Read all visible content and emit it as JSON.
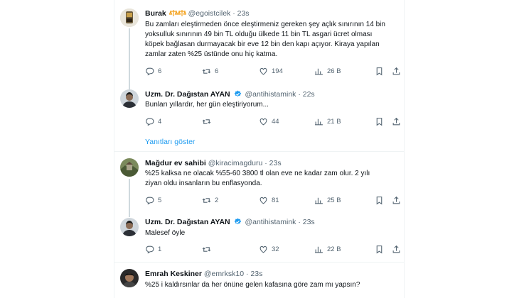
{
  "tweets": [
    {
      "name": "Burak",
      "handle": "@egoistcilek",
      "time": "· 23s",
      "lines": [
        "Bu zamları eleştirmeden önce eleştirmeniz gereken şey açlık sınırının 14 bin",
        "yoksulluk sınırının 49 bin TL olduğu ülkede 11 bin TL asgari ücret olması",
        "köpek bağlasan durmayacak bir eve 12 bin den kapı açıyor. Kiraya yapılan",
        "zamlar zaten %25 üstünde onu hiç katma."
      ],
      "replies": "6",
      "retweets": "6",
      "likes": "194",
      "views": "26 B"
    },
    {
      "name": "Uzm. Dr. Dağıstan AYAN",
      "handle": "@antihistamink",
      "time": "· 22s",
      "lines": [
        "Bunları yıllardır, her gün eleştiriyorum..."
      ],
      "replies": "4",
      "retweets": "",
      "likes": "44",
      "views": "21 B"
    },
    {
      "name": "Mağdur ev sahibi",
      "handle": "@kiracimagduru",
      "time": "· 23s",
      "lines": [
        "%25 kalksa ne olacak %55-60 3800 tl olan eve ne kadar zam olur. 2 yılı",
        "ziyan oldu insanların bu enflasyonda."
      ],
      "replies": "5",
      "retweets": "2",
      "likes": "81",
      "views": "25 B"
    },
    {
      "name": "Uzm. Dr. Dağıstan AYAN",
      "handle": "@antihistamink",
      "time": "· 23s",
      "lines": [
        "Malesef öyle"
      ],
      "replies": "1",
      "retweets": "",
      "likes": "32",
      "views": "22 B"
    },
    {
      "name": "Emrah Keskiner",
      "handle": "@emrksk10",
      "time": "· 23s",
      "lines": [
        "%25 i kaldırsınlar da her önüne gelen kafasına göre zam mı yapsın?"
      ]
    }
  ],
  "show_replies_label": "Yanıtları göster",
  "colors": {
    "accent": "#1d9bf0",
    "muted": "#536471",
    "text": "#0f1419",
    "line": "#cfd9de"
  },
  "icons": [
    "reply-icon",
    "retweet-icon",
    "like-icon",
    "views-icon",
    "bookmark-icon",
    "share-icon",
    "verified-icon",
    "balance-scale-emoji"
  ]
}
